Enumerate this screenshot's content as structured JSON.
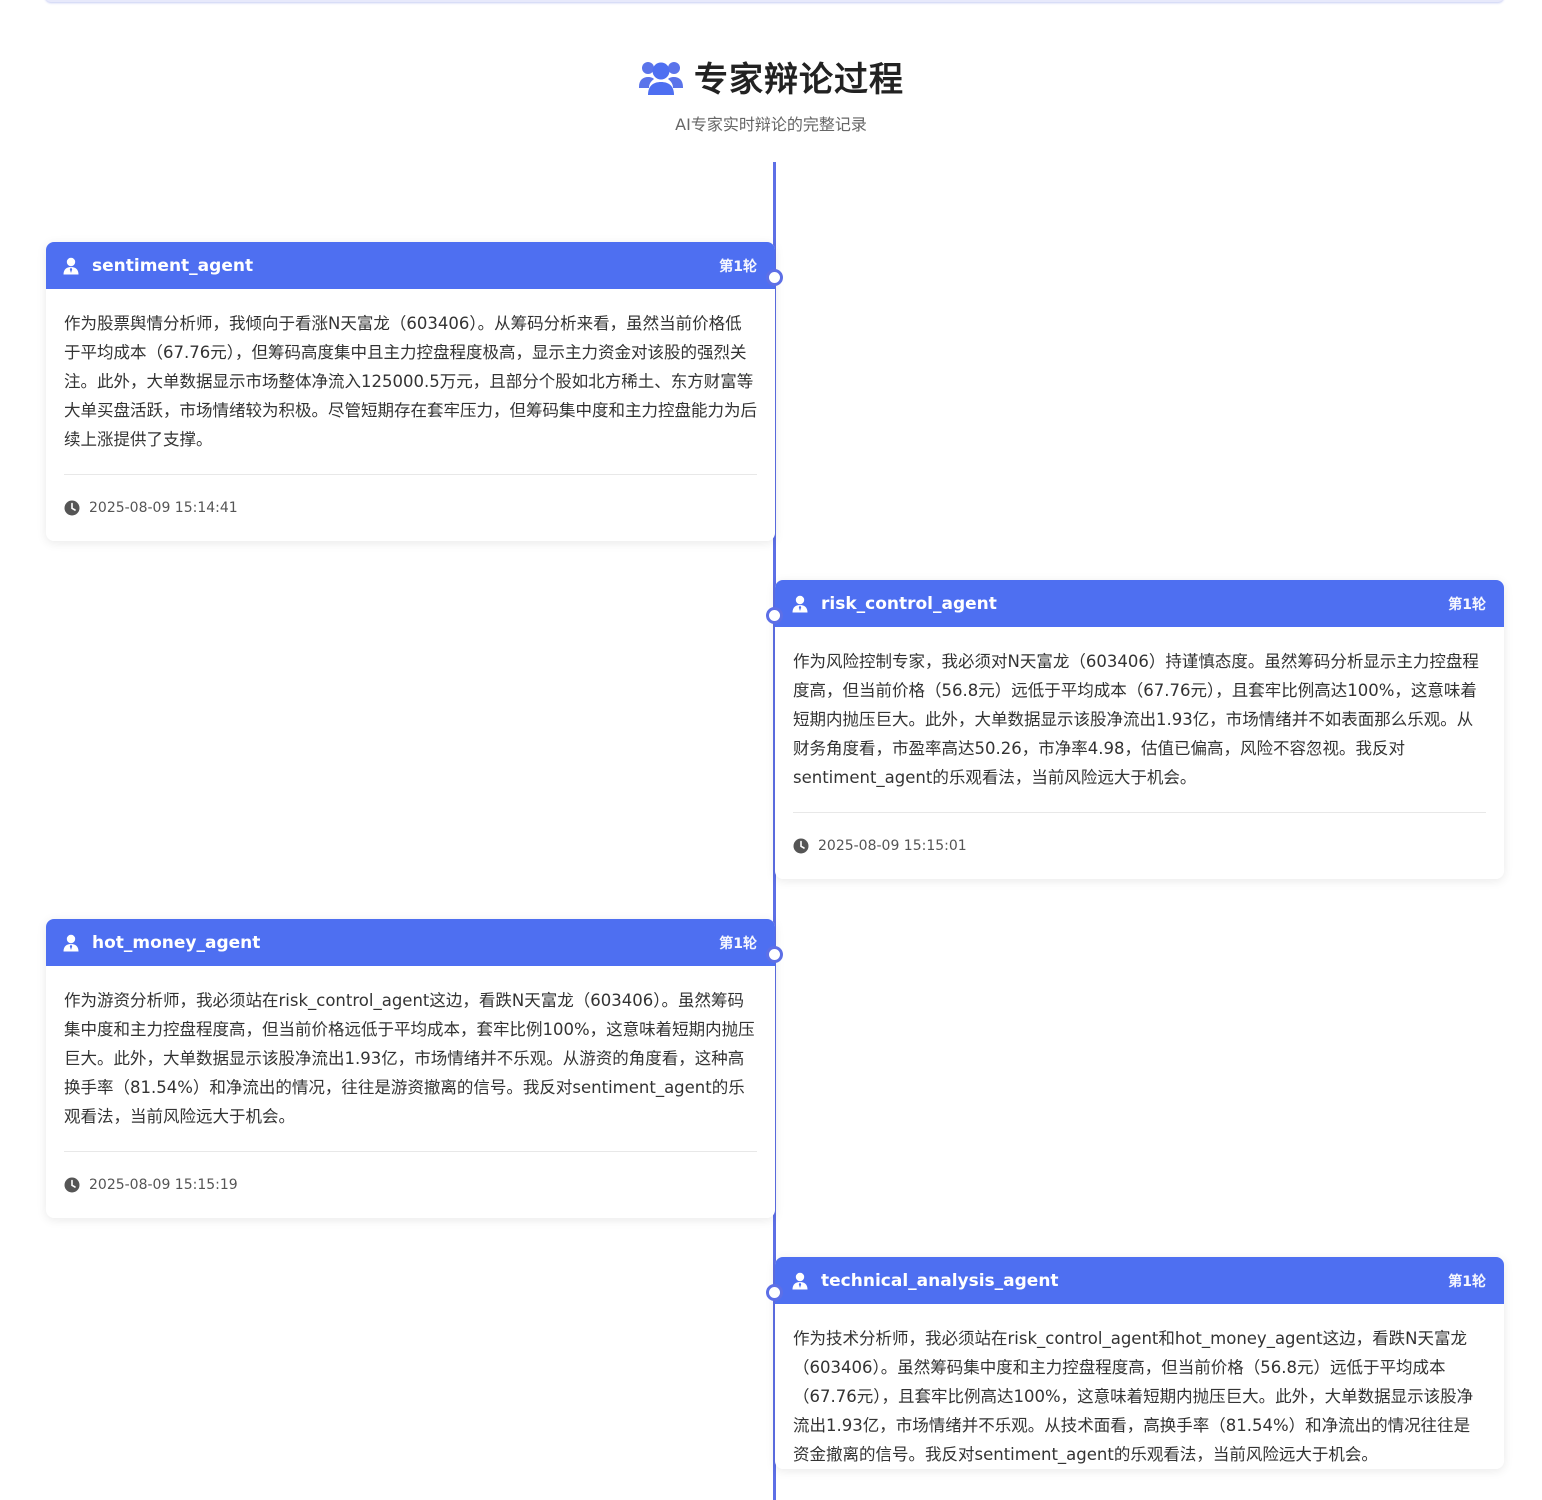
{
  "header": {
    "title": "专家辩论过程",
    "subtitle": "AI专家实时辩论的完整记录",
    "icon": "users-icon"
  },
  "colors": {
    "accent": "#4e6ff1",
    "timeline": "#5d6fe6"
  },
  "debate": [
    {
      "agent": "sentiment_agent",
      "round": "第1轮",
      "content": "作为股票舆情分析师，我倾向于看涨N天富龙（603406）。从筹码分析来看，虽然当前价格低于平均成本（67.76元），但筹码高度集中且主力控盘程度极高，显示主力资金对该股的强烈关注。此外，大单数据显示市场整体净流入125000.5万元，且部分个股如北方稀土、东方财富等大单买盘活跃，市场情绪较为积极。尽管短期存在套牢压力，但筹码集中度和主力控盘能力为后续上涨提供了支撑。",
      "time": "2025-08-09 15:14:41"
    },
    {
      "agent": "risk_control_agent",
      "round": "第1轮",
      "content": "作为风险控制专家，我必须对N天富龙（603406）持谨慎态度。虽然筹码分析显示主力控盘程度高，但当前价格（56.8元）远低于平均成本（67.76元），且套牢比例高达100%，这意味着短期内抛压巨大。此外，大单数据显示该股净流出1.93亿，市场情绪并不如表面那么乐观。从财务角度看，市盈率高达50.26，市净率4.98，估值已偏高，风险不容忽视。我反对sentiment_agent的乐观看法，当前风险远大于机会。",
      "time": "2025-08-09 15:15:01"
    },
    {
      "agent": "hot_money_agent",
      "round": "第1轮",
      "content": "作为游资分析师，我必须站在risk_control_agent这边，看跌N天富龙（603406）。虽然筹码集中度和主力控盘程度高，但当前价格远低于平均成本，套牢比例100%，这意味着短期内抛压巨大。此外，大单数据显示该股净流出1.93亿，市场情绪并不乐观。从游资的角度看，这种高换手率（81.54%）和净流出的情况，往往是游资撤离的信号。我反对sentiment_agent的乐观看法，当前风险远大于机会。",
      "time": "2025-08-09 15:15:19"
    },
    {
      "agent": "technical_analysis_agent",
      "round": "第1轮",
      "content": "作为技术分析师，我必须站在risk_control_agent和hot_money_agent这边，看跌N天富龙（603406）。虽然筹码集中度和主力控盘程度高，但当前价格（56.8元）远低于平均成本（67.76元），且套牢比例高达100%，这意味着短期内抛压巨大。此外，大单数据显示该股净流出1.93亿，市场情绪并不乐观。从技术面看，高换手率（81.54%）和净流出的情况往往是资金撤离的信号。我反对sentiment_agent的乐观看法，当前风险远大于机会。",
      "time": ""
    }
  ]
}
